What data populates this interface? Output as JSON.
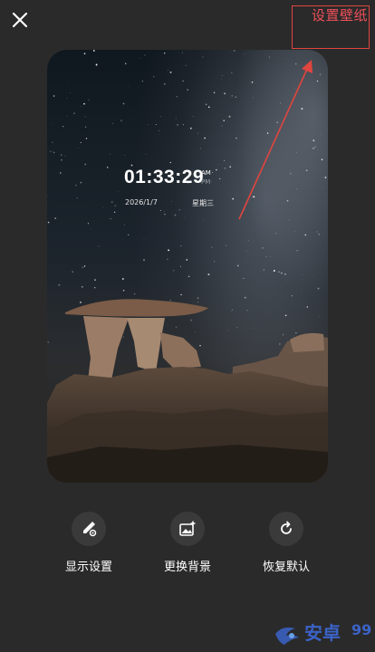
{
  "header": {
    "close_icon": "close-icon",
    "set_wallpaper_label": "设置壁纸",
    "annotation_color": "#e0453f"
  },
  "preview": {
    "time": "01:33:29",
    "am": "AM",
    "pm": "PM",
    "date": "2026/1/7",
    "weekday": "星期三"
  },
  "actions": [
    {
      "label": "显示设置",
      "icon": "brush-settings-icon"
    },
    {
      "label": "更换背景",
      "icon": "image-add-icon"
    },
    {
      "label": "恢复默认",
      "icon": "refresh-icon"
    }
  ],
  "watermark": {
    "text": "安卓",
    "number": "99",
    "color": "#3b63c8"
  }
}
